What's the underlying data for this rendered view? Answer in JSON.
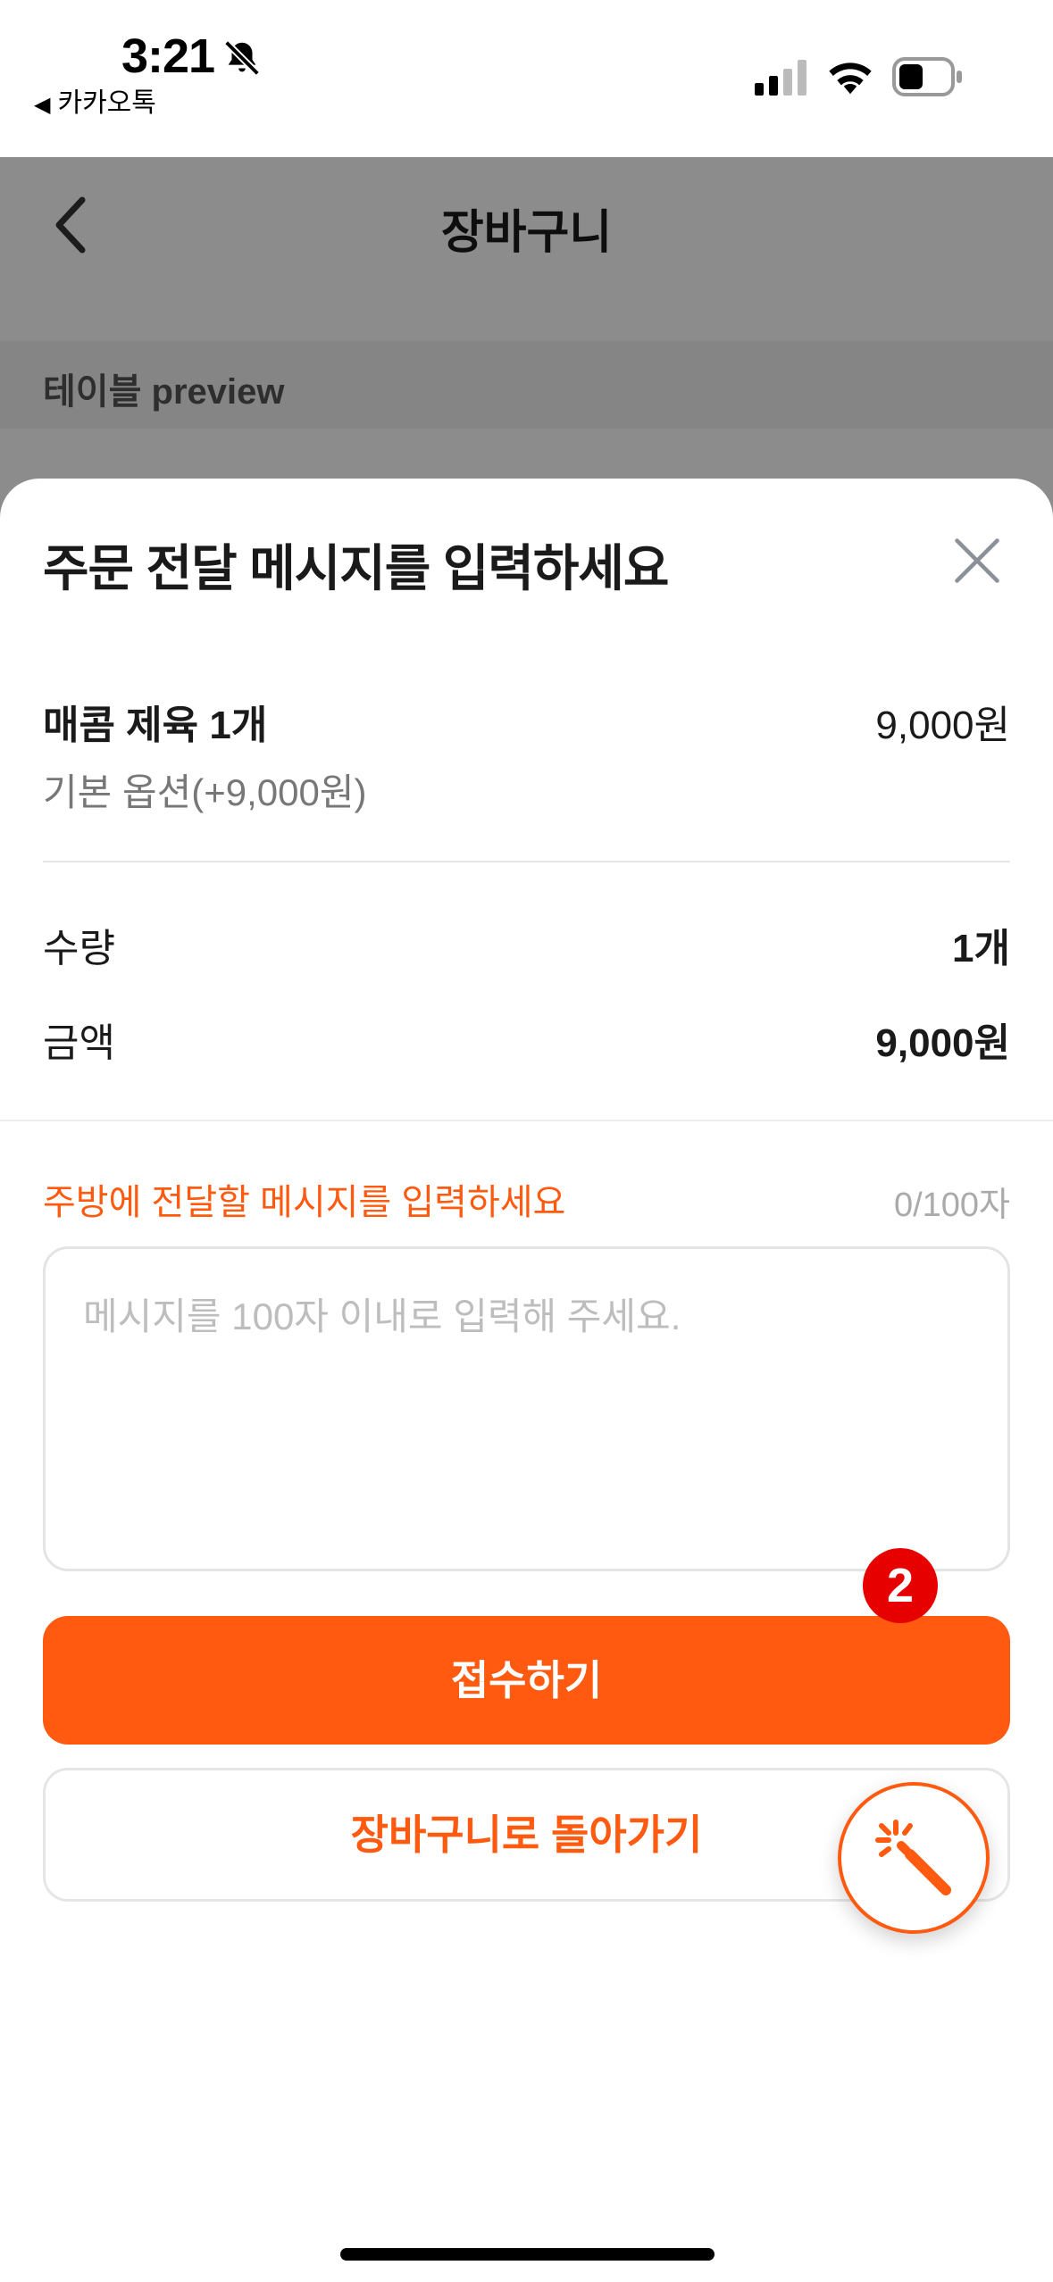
{
  "status_bar": {
    "time": "3:21",
    "back_app": "카카오톡",
    "icons": [
      "bell-slash-icon",
      "signal-icon",
      "wifi-icon",
      "battery-icon"
    ]
  },
  "background_page": {
    "title": "장바구니",
    "table_label": "테이블 preview"
  },
  "sheet": {
    "title": "주문 전달 메시지를 입력하세요",
    "item": {
      "name": "매콤 제육 1개",
      "price": "9,000원",
      "option": "기본 옵션(+9,000원)"
    },
    "quantity": {
      "label": "수량",
      "value": "1개"
    },
    "amount": {
      "label": "금액",
      "value": "9,000원"
    },
    "message": {
      "label": "주방에 전달할 메시지를 입력하세요",
      "count": "0/100자",
      "value": "",
      "placeholder": "메시지를 100자 이내로 입력해 주세요."
    },
    "submit_label": "접수하기",
    "back_label": "장바구니로 돌아가기",
    "badge": "2"
  },
  "colors": {
    "accent": "#ff5a10",
    "badge": "#e60000",
    "dim_overlay": "rgba(0,0,0,0.45)"
  }
}
